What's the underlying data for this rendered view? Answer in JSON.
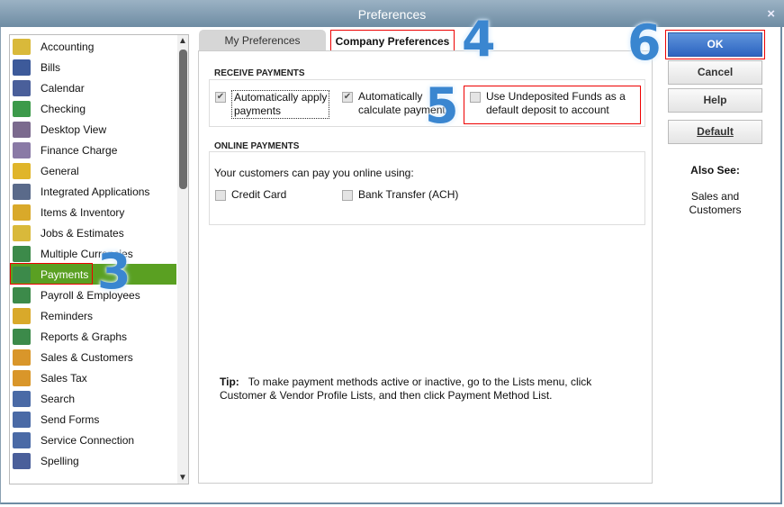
{
  "window": {
    "title": "Preferences",
    "close": "×"
  },
  "sidebar": {
    "items": [
      {
        "label": "Accounting",
        "icon": "accounting-icon",
        "color": "#d9b93a"
      },
      {
        "label": "Bills",
        "icon": "bills-icon",
        "color": "#3d5a9a"
      },
      {
        "label": "Calendar",
        "icon": "calendar-icon",
        "color": "#4a5f9a"
      },
      {
        "label": "Checking",
        "icon": "checking-icon",
        "color": "#3c9a4a"
      },
      {
        "label": "Desktop View",
        "icon": "desktop-view-icon",
        "color": "#7b6a8e"
      },
      {
        "label": "Finance Charge",
        "icon": "finance-charge-icon",
        "color": "#8a7aa6"
      },
      {
        "label": "General",
        "icon": "general-icon",
        "color": "#e0b52a"
      },
      {
        "label": "Integrated Applications",
        "icon": "integrated-applications-icon",
        "color": "#5a6a8a"
      },
      {
        "label": "Items & Inventory",
        "icon": "items-inventory-icon",
        "color": "#d9a92a"
      },
      {
        "label": "Jobs & Estimates",
        "icon": "jobs-estimates-icon",
        "color": "#d9b93a"
      },
      {
        "label": "Multiple Currencies",
        "icon": "multiple-currencies-icon",
        "color": "#3c8a4a"
      },
      {
        "label": "Payments",
        "icon": "payments-icon",
        "color": "#3c8a4a"
      },
      {
        "label": "Payroll & Employees",
        "icon": "payroll-employees-icon",
        "color": "#3c8a4a"
      },
      {
        "label": "Reminders",
        "icon": "reminders-icon",
        "color": "#d9a92a"
      },
      {
        "label": "Reports & Graphs",
        "icon": "reports-graphs-icon",
        "color": "#3c8a4a"
      },
      {
        "label": "Sales & Customers",
        "icon": "sales-customers-icon",
        "color": "#d9962a"
      },
      {
        "label": "Sales Tax",
        "icon": "sales-tax-icon",
        "color": "#d9962a"
      },
      {
        "label": "Search",
        "icon": "search-icon",
        "color": "#4a6aa6"
      },
      {
        "label": "Send Forms",
        "icon": "send-forms-icon",
        "color": "#4a6aa6"
      },
      {
        "label": "Service Connection",
        "icon": "service-connection-icon",
        "color": "#4a6aa6"
      },
      {
        "label": "Spelling",
        "icon": "spelling-icon",
        "color": "#4a5f9a"
      }
    ],
    "selected": "Payments"
  },
  "tabs": [
    {
      "label": "My Preferences"
    },
    {
      "label": "Company Preferences",
      "active": true
    }
  ],
  "receive": {
    "title": "RECEIVE PAYMENTS",
    "apply": {
      "label1": "Automatically apply",
      "label2": "payments",
      "checked": true
    },
    "calc": {
      "label1": "Automatically",
      "label2": "calculate payments",
      "checked": true
    },
    "undep": {
      "label1": "Use Undeposited Funds as a",
      "label2": "default deposit to account",
      "checked": false
    }
  },
  "online": {
    "title": "ONLINE PAYMENTS",
    "intro": "Your customers can pay you online using:",
    "credit": "Credit Card",
    "ach": "Bank Transfer (ACH)"
  },
  "tip": {
    "label": "Tip:",
    "line1": "To make payment methods active or inactive, go to the Lists menu, click",
    "line2": "Customer & Vendor Profile Lists, and then click Payment Method List."
  },
  "buttons": {
    "ok": "OK",
    "cancel": "Cancel",
    "help": "Help",
    "default": "Default"
  },
  "also_see": {
    "title": "Also See:",
    "link1": "Sales and",
    "link2": "Customers"
  },
  "annotations": {
    "a3": "3",
    "a4": "4",
    "a5": "5",
    "a6": "6"
  },
  "accent": "#2c64c0",
  "selection": "#5aa022"
}
